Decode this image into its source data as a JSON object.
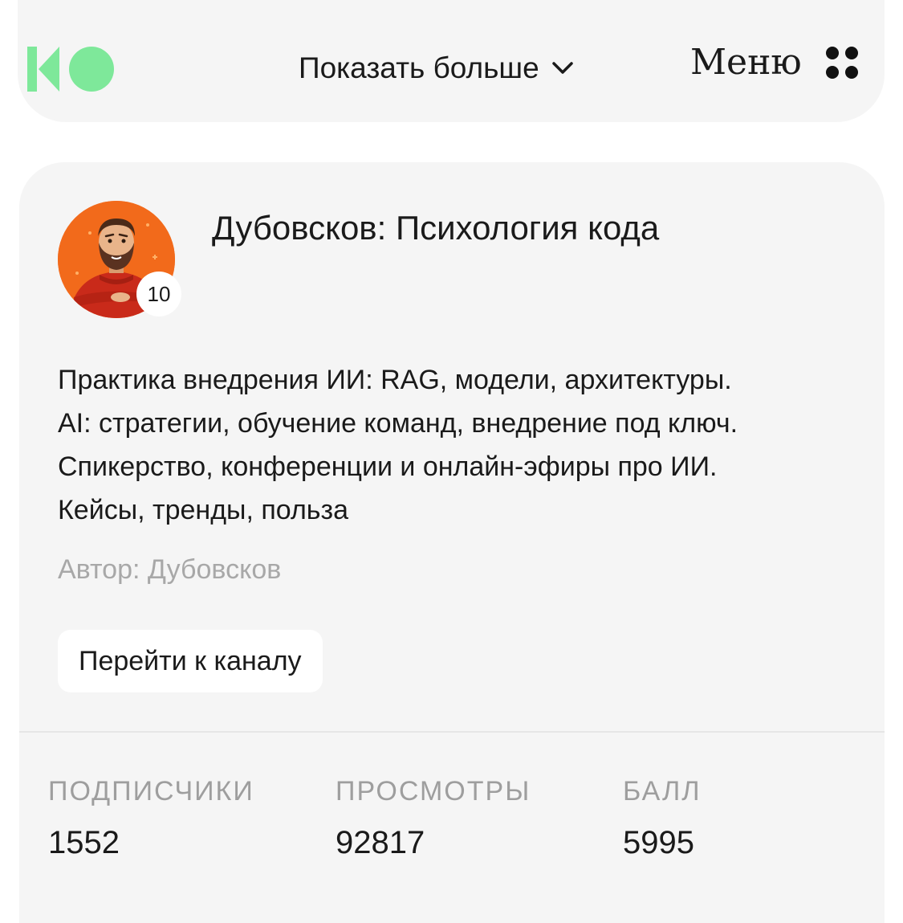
{
  "header": {
    "logo_icon": "tgstat-logo-icon",
    "show_more_label": "Показать больше",
    "show_more_icon": "chevron-down-icon",
    "menu_label": "Меню",
    "menu_icon": "dots-grid-icon"
  },
  "channel": {
    "title": "Дубовсков: Психология кода",
    "avatar_icon": "channel-avatar-illustration",
    "badge": "10",
    "description": [
      "Практика внедрения ИИ: RAG, модели, архитектуры.",
      "AI: стратегии, обучение команд, внедрение под ключ.",
      "Спикерство, конференции и онлайн-эфиры про ИИ.",
      "Кейсы, тренды, польза"
    ],
    "author": "Автор: Дубовсков",
    "go_button": "Перейти к каналу"
  },
  "stats": [
    {
      "label": "ПОДПИСЧИКИ",
      "value": "1552"
    },
    {
      "label": "ПРОСМОТРЫ",
      "value": "92817"
    },
    {
      "label": "БАЛЛ",
      "value": "5995"
    }
  ],
  "colors": {
    "logo_green": "#7ee89a",
    "card_bg": "#f5f5f5",
    "avatar_bg": "#f26a1b",
    "muted_text": "#a8a8a8"
  }
}
